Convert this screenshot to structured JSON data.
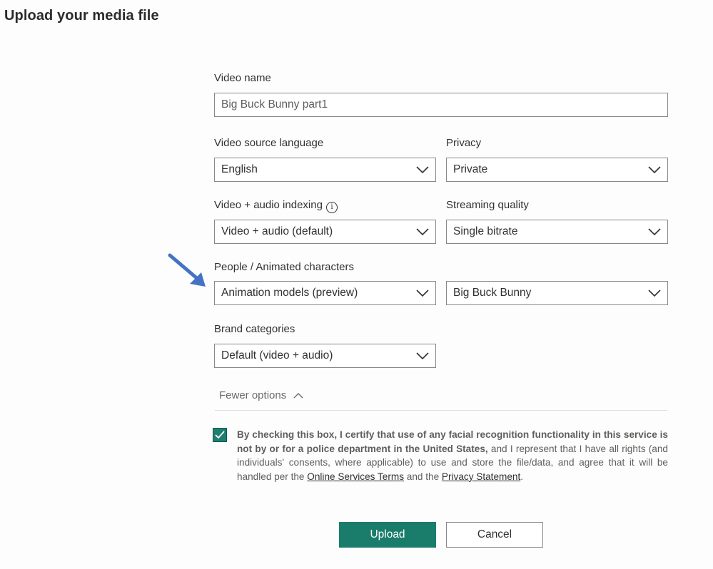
{
  "title": "Upload your media file",
  "video_name": {
    "label": "Video name",
    "value": "Big Buck Bunny part1"
  },
  "source_language": {
    "label": "Video source language",
    "value": "English"
  },
  "privacy": {
    "label": "Privacy",
    "value": "Private"
  },
  "indexing": {
    "label": "Video + audio indexing",
    "value": "Video + audio (default)",
    "info_glyph": "i"
  },
  "streaming": {
    "label": "Streaming quality",
    "value": "Single bitrate"
  },
  "people": {
    "label": "People / Animated characters",
    "model_value": "Animation models (preview)",
    "character_value": "Big Buck Bunny"
  },
  "brand": {
    "label": "Brand categories",
    "value": "Default (video + audio)"
  },
  "fewer_options": "Fewer options",
  "consent": {
    "checked": true,
    "bold_text": "By checking this box, I certify that use of any facial recognition functionality in this service is not by or for a police department in the United States,",
    "text_1": " and I represent that I have all rights (and individuals' consents, where applicable) to use and store the file/data, and agree that it will be handled per the ",
    "link_terms": "Online Services Terms",
    "text_2": " and the ",
    "link_privacy": "Privacy Statement",
    "text_3": "."
  },
  "buttons": {
    "upload": "Upload",
    "cancel": "Cancel"
  },
  "colors": {
    "primary": "#1a7d6b",
    "arrow": "#4472c4",
    "border": "#8a8886"
  },
  "icons": {
    "chevron": "chevron-down-icon",
    "chevron_up": "chevron-up-icon",
    "info": "info-icon",
    "check": "checkmark-icon",
    "arrow": "annotation-arrow-icon"
  }
}
